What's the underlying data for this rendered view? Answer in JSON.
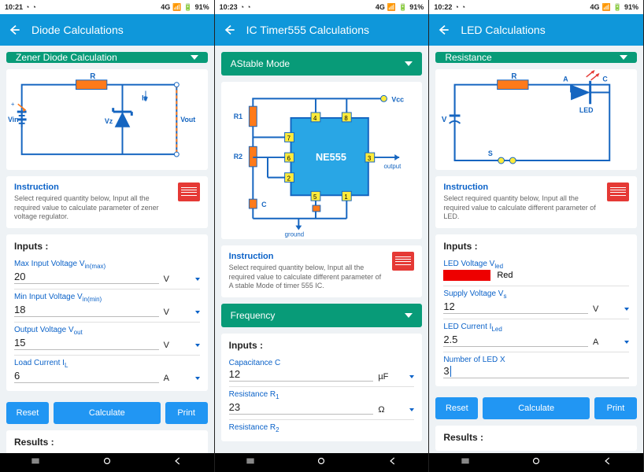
{
  "screens": [
    {
      "status": {
        "time": "10:21",
        "battery": "91%"
      },
      "title": "Diode Calculations",
      "dropdown": "Zener Diode Calculation",
      "instruction": {
        "heading": "Instruction",
        "body": "Select required quantity below, Input all the required value to calculate parameter of zener voltage regulator."
      },
      "inputs_label": "Inputs :",
      "results_label": "Results :",
      "fields": [
        {
          "label": "Max Input Voltage V",
          "sub": "in(max)",
          "value": "20",
          "unit": "V"
        },
        {
          "label": "Min Input Voltage V",
          "sub": "in(min)",
          "value": "18",
          "unit": "V"
        },
        {
          "label": "Output Voltage V",
          "sub": "out",
          "value": "15",
          "unit": "V"
        },
        {
          "label": "Load Current I",
          "sub": "L",
          "value": "6",
          "unit": "A"
        }
      ],
      "buttons": {
        "reset": "Reset",
        "calc": "Calculate",
        "print": "Print"
      }
    },
    {
      "status": {
        "time": "10:23",
        "battery": "91%"
      },
      "title": "IC Timer555 Calculations",
      "dropdown": "AStable Mode",
      "instruction": {
        "heading": "Instruction",
        "body": "Select required quantity below, Input all the required value to calculate different parameter of A stable Mode of timer 555 IC."
      },
      "dropdown2": "Frequency",
      "inputs_label": "Inputs :",
      "fields": [
        {
          "label": "Capacitance C",
          "value": "12",
          "unit": "µF"
        },
        {
          "label": "Resistance R",
          "sub": "1",
          "value": "23",
          "unit": "Ω"
        },
        {
          "label": "Resistance R",
          "sub": "2"
        }
      ]
    },
    {
      "status": {
        "time": "10:22",
        "battery": "91%"
      },
      "title": "LED Calculations",
      "dropdown": "Resistance",
      "instruction": {
        "heading": "Instruction",
        "body": "Select required quantity below, Input all the required value to calculate different parameter of LED."
      },
      "inputs_label": "Inputs :",
      "results_label": "Results :",
      "fields": [
        {
          "label": "LED Voltage V",
          "sub": "led",
          "color": "Red"
        },
        {
          "label": "Supply Voltage V",
          "sub": "s",
          "value": "12",
          "unit": "V"
        },
        {
          "label": "LED Current I",
          "sub": "Led",
          "value": "2.5",
          "unit": "A"
        },
        {
          "label": "Number of LED X",
          "value": "3",
          "cursor": true
        }
      ],
      "buttons": {
        "reset": "Reset",
        "calc": "Calculate",
        "print": "Print"
      }
    }
  ],
  "status_net": "4G",
  "circuit_labels": {
    "s0": {
      "R": "R",
      "Iz": "Iz",
      "Vin": "Vin",
      "Vz": "Vz",
      "Vout": "Vout"
    },
    "s1": {
      "Vcc": "Vcc",
      "R1": "R1",
      "R2": "R2",
      "C": "C",
      "ground": "ground",
      "output": "output",
      "chip": "NE555"
    },
    "s2": {
      "R": "R",
      "A": "A",
      "C": "C",
      "LED": "LED",
      "V": "V",
      "S": "S"
    }
  }
}
